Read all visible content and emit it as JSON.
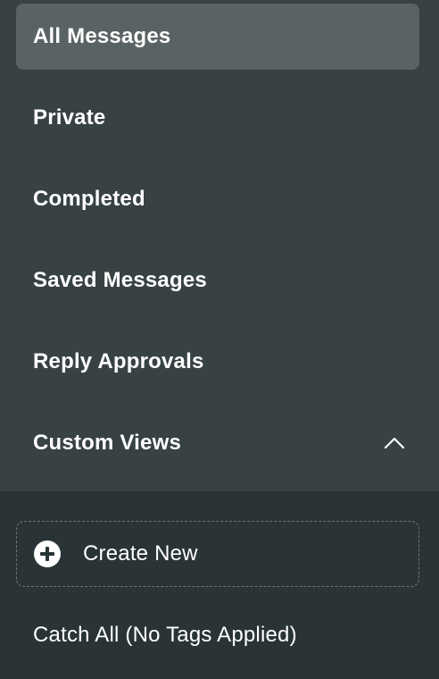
{
  "nav": {
    "items": [
      {
        "label": "All Messages",
        "active": true
      },
      {
        "label": "Private",
        "active": false
      },
      {
        "label": "Completed",
        "active": false
      },
      {
        "label": "Saved Messages",
        "active": false
      },
      {
        "label": "Reply Approvals",
        "active": false
      },
      {
        "label": "Custom Views",
        "active": false,
        "expanded": true,
        "icon": "chevron-up-icon"
      }
    ]
  },
  "custom_views": {
    "create_new": {
      "label": "Create New",
      "icon": "plus-circle-icon"
    },
    "views": [
      {
        "label": "Catch All (No Tags Applied)"
      }
    ]
  },
  "colors": {
    "top_background": "#384244",
    "bottom_background": "#2a3436",
    "active_item": "#5a6364",
    "text": "#ffffff",
    "dashed_border": "#6b7476"
  }
}
